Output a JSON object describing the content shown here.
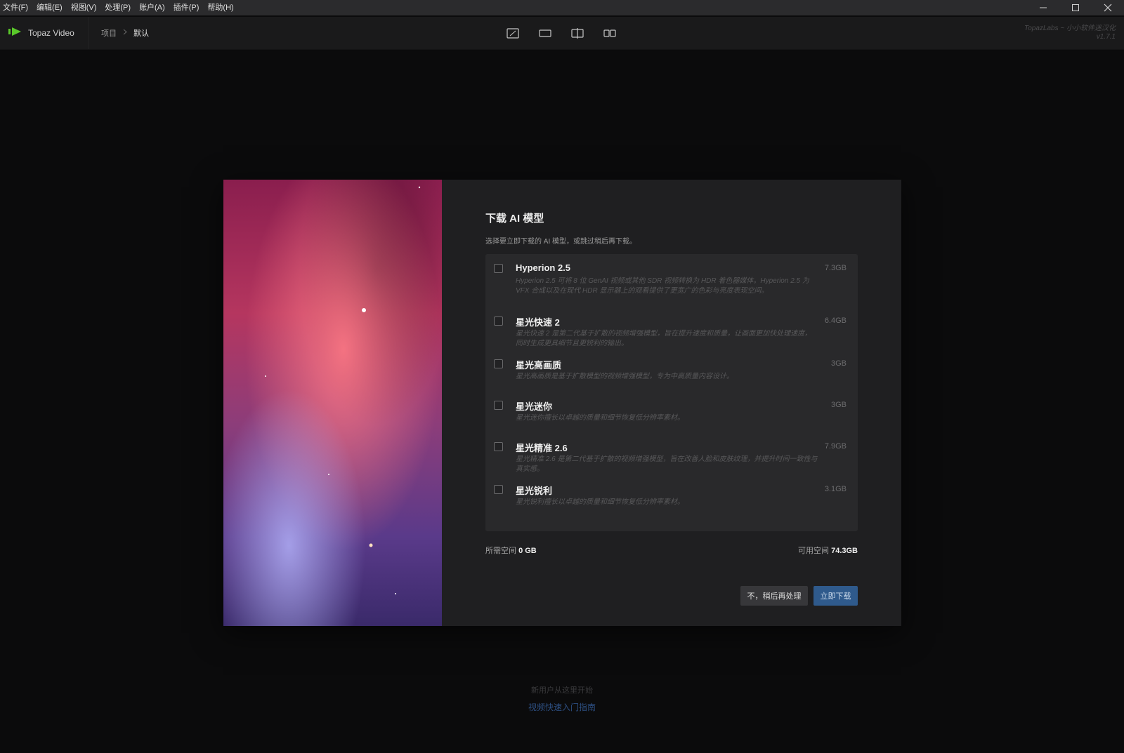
{
  "menubar": {
    "items": [
      "文件(F)",
      "编辑(E)",
      "视图(V)",
      "处理(P)",
      "账户(A)",
      "插件(P)",
      "帮助(H)"
    ]
  },
  "window_controls": {
    "icons": [
      "minimize-icon",
      "maximize-icon",
      "close-icon"
    ]
  },
  "toolbar": {
    "app_name": "Topaz Video",
    "breadcrumb": [
      "项目",
      "默认"
    ],
    "view_modes": [
      "single-view-icon",
      "wide-view-icon",
      "split-view-icon",
      "side-by-side-view-icon"
    ],
    "version_line1": "TopazLabs ~ 小小软件迷汉化",
    "version_line2": "v1.7.1"
  },
  "dialog": {
    "title": "下载 AI 模型",
    "subtitle": "选择要立即下载的 AI 模型，或跳过稍后再下载。",
    "models": [
      {
        "name": "Hyperion 2.5",
        "size": "7.3GB",
        "desc": "Hyperion 2.5 可将 8 位 GenAI 视频或其他 SDR 视频转换为 HDR 着色器媒体。Hyperion 2.5 为 VFX 合成以及在现代 HDR 显示器上的观看提供了更宽广的色彩与亮度表现空间。"
      },
      {
        "name": "星光快速 2",
        "size": "6.4GB",
        "desc": "星光快速 2 是第二代基于扩散的视频增强模型，旨在提升速度和质量，让画面更加快处理速度，同时生成更具细节且更锐利的输出。"
      },
      {
        "name": "星光高画质",
        "size": "3GB",
        "desc": "星光高画质是基于扩散模型的视频增强模型，专为中高质量内容设计。"
      },
      {
        "name": "星光迷你",
        "size": "3GB",
        "desc": "星光迷你擅长以卓越的质量和细节恢复低分辨率素材。"
      },
      {
        "name": "星光精准 2.6",
        "size": "7.9GB",
        "desc": "星光精准 2.6 是第二代基于扩散的视频增强模型，旨在改善人脸和皮肤纹理，并提升时间一致性与真实感。"
      },
      {
        "name": "星光锐利",
        "size": "3.1GB",
        "desc": "星光锐利擅长以卓越的质量和细节恢复低分辨率素材。"
      }
    ],
    "space_required_label": "所需空间",
    "space_required_value": "0 GB",
    "space_available_label": "可用空间",
    "space_available_value": "74.3GB",
    "later_button": "不，稍后再处理",
    "download_button": "立即下载"
  },
  "footer": {
    "new_user_text": "新用户从这里开始",
    "guide_link": "视频快速入门指南"
  },
  "colors": {
    "accent": "#2f5a8c",
    "brand_green": "#5ac82a",
    "dialog_bg": "#1f1f21"
  }
}
